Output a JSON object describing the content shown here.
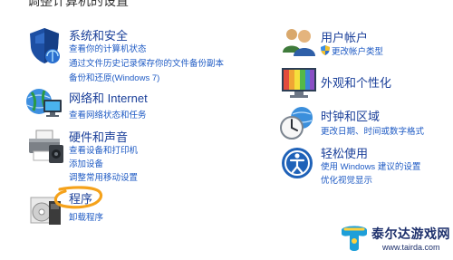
{
  "header": {
    "text": "调整计算机的设置"
  },
  "categories": {
    "system": {
      "title": "系统和安全",
      "icon": "system-security-shield-icon",
      "links": [
        "查看你的计算机状态",
        "通过文件历史记录保存你的文件备份副本",
        "备份和还原(Windows 7)"
      ]
    },
    "network": {
      "title": "网络和 Internet",
      "icon": "network-globe-icon",
      "links": [
        "查看网络状态和任务"
      ]
    },
    "hardware": {
      "title": "硬件和声音",
      "icon": "printer-speaker-icon",
      "links": [
        "查看设备和打印机",
        "添加设备",
        "调整常用移动设置"
      ]
    },
    "programs": {
      "title": "程序",
      "icon": "programs-disc-icon",
      "links": [
        "卸载程序"
      ]
    },
    "users": {
      "title": "用户帐户",
      "icon": "user-accounts-icon",
      "links": [
        "更改帐户类型"
      ]
    },
    "appearance": {
      "title": "外观和个性化",
      "icon": "display-personalization-icon",
      "links": []
    },
    "clock": {
      "title": "时钟和区域",
      "icon": "clock-globe-icon",
      "links": [
        "更改日期、时间或数字格式"
      ]
    },
    "ease": {
      "title": "轻松使用",
      "icon": "ease-of-access-icon",
      "links": [
        "使用 Windows 建议的设置",
        "优化视觉显示"
      ]
    }
  },
  "watermark": {
    "title": "泰尔达游戏网",
    "url": "www.tairda.com"
  },
  "colors": {
    "title_blue": "#1a3f99",
    "link_blue": "#1f5bc4",
    "highlight_orange": "#f5a21b"
  }
}
